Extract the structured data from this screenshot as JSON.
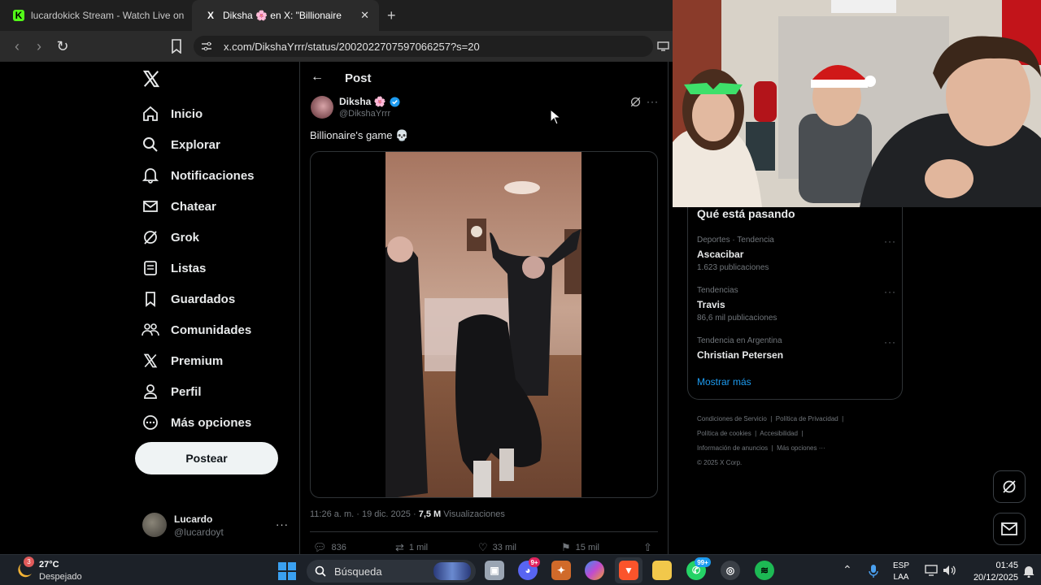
{
  "browser": {
    "tabs": [
      {
        "label": "lucardokick Stream - Watch Live on K",
        "favicon": "K"
      },
      {
        "label": "Diksha 🌸 en X: \"Billionaire's",
        "favicon": "X"
      }
    ],
    "url": "x.com/DikshaYrrr/status/2002022707597066257?s=20"
  },
  "sidebar": {
    "items": [
      {
        "label": "Inicio",
        "icon": "home-icon"
      },
      {
        "label": "Explorar",
        "icon": "search-icon"
      },
      {
        "label": "Notificaciones",
        "icon": "bell-icon"
      },
      {
        "label": "Chatear",
        "icon": "mail-icon"
      },
      {
        "label": "Grok",
        "icon": "grok-icon"
      },
      {
        "label": "Listas",
        "icon": "list-icon"
      },
      {
        "label": "Guardados",
        "icon": "bookmark-icon"
      },
      {
        "label": "Comunidades",
        "icon": "people-icon"
      },
      {
        "label": "Premium",
        "icon": "x-icon"
      },
      {
        "label": "Perfil",
        "icon": "person-icon"
      },
      {
        "label": "Más opciones",
        "icon": "more-icon"
      }
    ],
    "post_label": "Postear",
    "account": {
      "name": "Lucardo",
      "handle": "@lucardoyt"
    }
  },
  "post": {
    "header": "Post",
    "author_name": "Diksha 🌸",
    "author_handle": "@DikshaYrrr",
    "text": "Billionaire's game 💀",
    "timestamp": "11:26 a. m. · 19 dic. 2025 · ",
    "views_count": "7,5 M",
    "views_label": " Visualizaciones",
    "replies": "836",
    "reposts": "1 mil",
    "likes": "33 mil",
    "bookmarks": "15 mil"
  },
  "trends": {
    "title": "Qué está pasando",
    "items": [
      {
        "context": "Deportes · Tendencia",
        "name": "Ascacibar",
        "count": "1.623 publicaciones"
      },
      {
        "context": "Tendencias",
        "name": "Travis",
        "count": "86,6 mil publicaciones"
      },
      {
        "context": "Tendencia en Argentina",
        "name": "Christian Petersen",
        "count": ""
      }
    ],
    "show_more": "Mostrar más"
  },
  "footer": {
    "line1": [
      "Condiciones de Servicio",
      "Política de Privacidad"
    ],
    "line2": [
      "Política de cookies",
      "Accesibilidad"
    ],
    "line3": [
      "Información de anuncios",
      "Más opciones ···"
    ],
    "copyright": "© 2025 X Corp."
  },
  "taskbar": {
    "weather_temp": "27°C",
    "weather_desc": "Despejado",
    "weather_badge": "3",
    "search_label": "Búsqueda",
    "lang_top": "ESP",
    "lang_bottom": "LAA",
    "time": "01:45",
    "date": "20/12/2025",
    "discord_badge": "9+",
    "whatsapp_badge": "99+"
  },
  "colors": {
    "accent": "#1d9bf0",
    "background": "#000000",
    "border": "#2f3336"
  }
}
